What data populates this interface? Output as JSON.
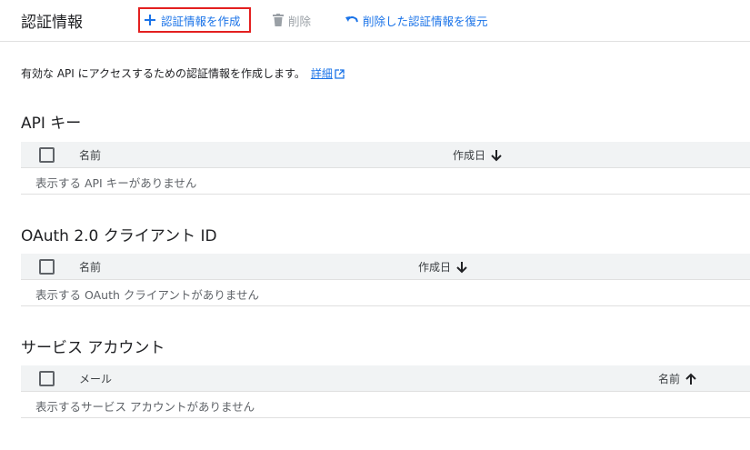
{
  "header": {
    "title": "認証情報",
    "create_label": "認証情報を作成",
    "delete_label": "削除",
    "restore_label": "削除した認証情報を復元"
  },
  "intro": {
    "text": "有効な API にアクセスするための認証情報を作成します。",
    "link_label": "詳細"
  },
  "sections": [
    {
      "title": "API キー",
      "col1": "名前",
      "col2": "作成日",
      "sort": "down",
      "empty_text": "表示する API キーがありません"
    },
    {
      "title": "OAuth 2.0 クライアント ID",
      "col1": "名前",
      "col2": "作成日",
      "sort": "down",
      "empty_text": "表示する OAuth クライアントがありません"
    },
    {
      "title": "サービス アカウント",
      "col1": "メール",
      "col2": "名前",
      "sort": "up",
      "empty_text": "表示するサービス アカウントがありません"
    }
  ],
  "colors": {
    "accent": "#1a73e8",
    "highlight_border": "#e32020",
    "disabled": "#9aa0a6",
    "header_bg": "#f1f3f4"
  }
}
